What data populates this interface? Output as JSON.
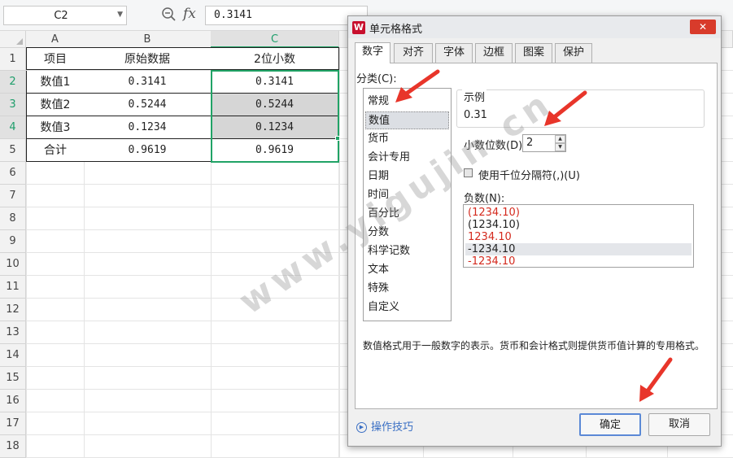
{
  "formula_bar": {
    "name_box": "C2",
    "fx_label": "fx",
    "formula_value": "0.3141"
  },
  "grid": {
    "columns": [
      "A",
      "B",
      "C"
    ],
    "rows": [
      "1",
      "2",
      "3",
      "4",
      "5",
      "6",
      "7",
      "8",
      "9",
      "10",
      "11",
      "12",
      "13",
      "14",
      "15",
      "16",
      "17",
      "18"
    ],
    "table": [
      [
        "项目",
        "原始数据",
        "2位小数"
      ],
      [
        "数值1",
        "0.3141",
        "0.3141"
      ],
      [
        "数值2",
        "0.5244",
        "0.5244"
      ],
      [
        "数值3",
        "0.1234",
        "0.1234"
      ],
      [
        "合计",
        "0.9619",
        "0.9619"
      ]
    ]
  },
  "dialog": {
    "title": "单元格格式",
    "logo": "W",
    "close": "✕",
    "tabs": [
      "数字",
      "对齐",
      "字体",
      "边框",
      "图案",
      "保护"
    ],
    "category_label": "分类(C):",
    "categories": [
      "常规",
      "数值",
      "货币",
      "会计专用",
      "日期",
      "时间",
      "百分比",
      "分数",
      "科学记数",
      "文本",
      "特殊",
      "自定义"
    ],
    "selected_category": "数值",
    "sample_label": "示例",
    "sample_value": "0.31",
    "decimal_label": "小数位数(D):",
    "decimal_value": "2",
    "thousands_label": "使用千位分隔符(,)(U)",
    "negative_label": "负数(N):",
    "negative_options": [
      {
        "text": "(1234.10)",
        "color": "#d42a1e"
      },
      {
        "text": "(1234.10)",
        "color": "#222222"
      },
      {
        "text": "1234.10",
        "color": "#d42a1e"
      },
      {
        "text": "-1234.10",
        "color": "#222222"
      },
      {
        "text": "-1234.10",
        "color": "#d42a1e"
      }
    ],
    "description": "数值格式用于一般数字的表示。货币和会计格式则提供货币值计算的专用格式。",
    "tips_link": "操作技巧",
    "ok_button": "确定",
    "cancel_button": "取消"
  },
  "watermark": "www.yigujin.cn",
  "colors": {
    "selection_green": "#21a366",
    "annotation_red": "#e8352a",
    "negative_red": "#d42a1e"
  }
}
